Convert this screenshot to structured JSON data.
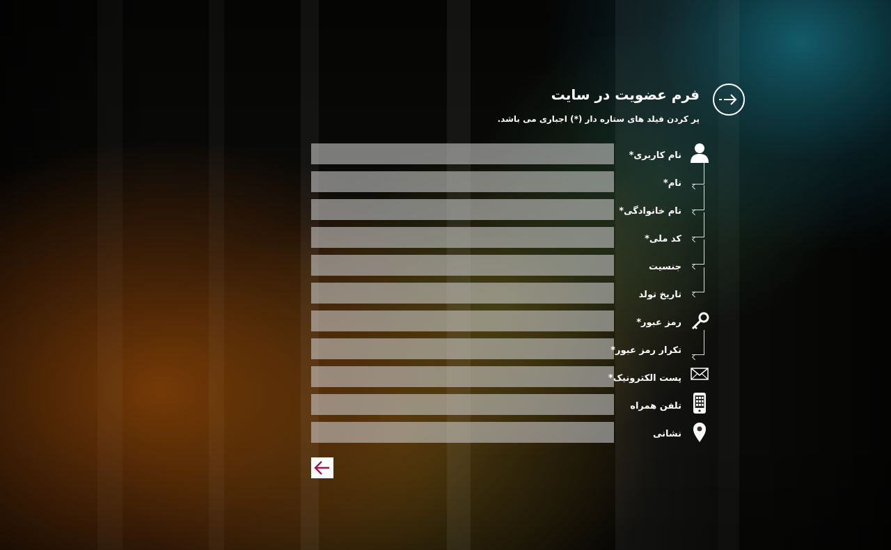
{
  "header": {
    "title": "فرم عضویت در سایت",
    "subtitle": "پر کردن فیلد های ستاره دار (*) اجباری می باشد."
  },
  "fields": [
    {
      "label": "نام کاربری*",
      "value": "",
      "icon": "user-icon"
    },
    {
      "label": "نام*",
      "value": "",
      "icon": "branch-arrow"
    },
    {
      "label": "نام خانوادگی*",
      "value": "",
      "icon": "branch-arrow"
    },
    {
      "label": "کد ملی*",
      "value": "",
      "icon": "branch-arrow"
    },
    {
      "label": "جنسیت",
      "value": "",
      "icon": "branch-arrow"
    },
    {
      "label": "تاریخ تولد",
      "value": "",
      "icon": "branch-arrow"
    },
    {
      "label": "رمز عبور*",
      "value": "",
      "icon": "key-icon"
    },
    {
      "label": "تکرار رمز عبور*",
      "value": "",
      "icon": "branch-arrow"
    },
    {
      "label": "پست الکترونیک*",
      "value": "",
      "icon": "envelope-icon"
    },
    {
      "label": "تلفن همراه",
      "value": "",
      "icon": "mobile-phone-icon"
    },
    {
      "label": "نشانی",
      "value": "",
      "icon": "location-pin-icon"
    }
  ],
  "submit": {
    "icon": "arrow-left-icon",
    "color": "#a0144a"
  },
  "colors": {
    "input_background": "#b8b8b0",
    "text": "#ffffff"
  }
}
